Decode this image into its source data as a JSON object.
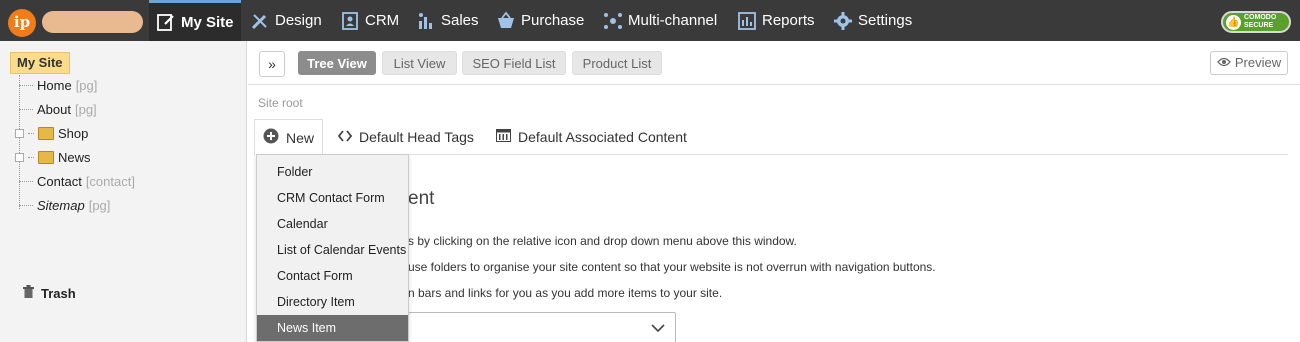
{
  "topbar": {
    "logo_text": "ip",
    "nav": [
      {
        "label": "My Site",
        "icon": "edit-page-icon",
        "active": true
      },
      {
        "label": "Design",
        "icon": "design-tools-icon",
        "active": false
      },
      {
        "label": "CRM",
        "icon": "contact-card-icon",
        "active": false
      },
      {
        "label": "Sales",
        "icon": "sales-chart-icon",
        "active": false
      },
      {
        "label": "Purchase",
        "icon": "purchase-basket-icon",
        "active": false
      },
      {
        "label": "Multi-channel",
        "icon": "network-icon",
        "active": false
      },
      {
        "label": "Reports",
        "icon": "reports-icon",
        "active": false
      },
      {
        "label": "Settings",
        "icon": "gear-icon",
        "active": false
      }
    ],
    "comodo": {
      "line1": "COMODO",
      "line2": "SECURE"
    }
  },
  "sidebar": {
    "root_label": "My Site",
    "tree": [
      {
        "label": "Home",
        "tag": "[pg]",
        "folder": false,
        "italic": false
      },
      {
        "label": "About",
        "tag": "[pg]",
        "folder": false,
        "italic": false
      },
      {
        "label": "Shop",
        "tag": "",
        "folder": true,
        "italic": false
      },
      {
        "label": "News",
        "tag": "",
        "folder": true,
        "italic": false
      },
      {
        "label": "Contact",
        "tag": "[contact]",
        "folder": false,
        "italic": false
      },
      {
        "label": "Sitemap",
        "tag": "[pg]",
        "folder": false,
        "italic": true
      }
    ],
    "trash_label": "Trash"
  },
  "toolbar": {
    "expand_label": "»",
    "views": [
      "Tree View",
      "List View",
      "SEO Field List",
      "Product List"
    ],
    "active_view": "Tree View",
    "preview_label": "Preview"
  },
  "breadcrumb": "Site root",
  "tabs": {
    "new_label": "New",
    "head_tags_label": "Default Head Tags",
    "associated_label": "Default Associated Content"
  },
  "content": {
    "heading_partial": "ent",
    "lines": [
      "s by clicking on the relative icon and drop down menu above this window.",
      "use folders to organise your site content so that your website is not overrun with navigation buttons.",
      "n bars and links for you as you add more items to your site."
    ]
  },
  "dropdown": {
    "items": [
      "Folder",
      "CRM Contact Form",
      "Calendar",
      "List of Calendar Events",
      "Contact Form",
      "Directory Item",
      "News Item"
    ],
    "highlighted": "News Item"
  },
  "colors": {
    "topbar": "#3a3a3a",
    "accent_orange": "#f07d1a",
    "root_highlight": "#fbdc8c",
    "active_view": "#8c8c8c",
    "dropdown_highlight": "#6d6d6d",
    "comodo_green": "#5aa02c"
  }
}
